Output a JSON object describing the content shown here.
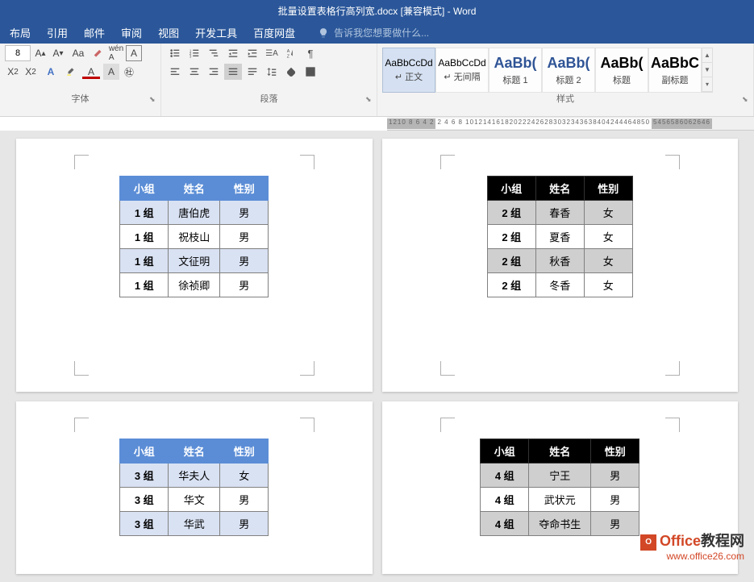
{
  "titlebar": {
    "filename": "批量设置表格行高列宽.docx",
    "mode": "[兼容模式]",
    "app": "Word"
  },
  "tabs": [
    "布局",
    "引用",
    "邮件",
    "审阅",
    "视图",
    "开发工具",
    "百度网盘"
  ],
  "tell_me": "告诉我您想要做什么...",
  "ribbon": {
    "font_size": "8",
    "font_group": "字体",
    "para_group": "段落",
    "styles_group": "样式"
  },
  "styles": [
    {
      "preview": "AaBbCcDd",
      "name": "↵ 正文",
      "class": ""
    },
    {
      "preview": "AaBbCcDd",
      "name": "↵ 无间隔",
      "class": ""
    },
    {
      "preview": "AaBb(",
      "name": "标题 1",
      "class": "big blue"
    },
    {
      "preview": "AaBb(",
      "name": "标题 2",
      "class": "big blue"
    },
    {
      "preview": "AaBb(",
      "name": "标题",
      "class": "big"
    },
    {
      "preview": "AaBbC",
      "name": "副标题",
      "class": "big"
    }
  ],
  "tables": {
    "headers": [
      "小组",
      "姓名",
      "性别"
    ],
    "t1": [
      [
        "1 组",
        "唐伯虎",
        "男"
      ],
      [
        "1 组",
        "祝枝山",
        "男"
      ],
      [
        "1 组",
        "文征明",
        "男"
      ],
      [
        "1 组",
        "徐祯卿",
        "男"
      ]
    ],
    "t2": [
      [
        "2 组",
        "春香",
        "女"
      ],
      [
        "2 组",
        "夏香",
        "女"
      ],
      [
        "2 组",
        "秋香",
        "女"
      ],
      [
        "2 组",
        "冬香",
        "女"
      ]
    ],
    "t3": [
      [
        "3 组",
        "华夫人",
        "女"
      ],
      [
        "3 组",
        "华文",
        "男"
      ],
      [
        "3 组",
        "华武",
        "男"
      ]
    ],
    "t4": [
      [
        "4 组",
        "宁王",
        "男"
      ],
      [
        "4 组",
        "武状元",
        "男"
      ],
      [
        "4 组",
        "夺命书生",
        "男"
      ]
    ]
  },
  "ruler": {
    "left": "1210 8 6 4 2",
    "mid": "2 4 6 8 101214161820222426283032343638404244464850",
    "right": "5456586062646"
  },
  "watermark": {
    "brand1": "Office",
    "brand2": "教程网",
    "url": "www.office26.com"
  }
}
